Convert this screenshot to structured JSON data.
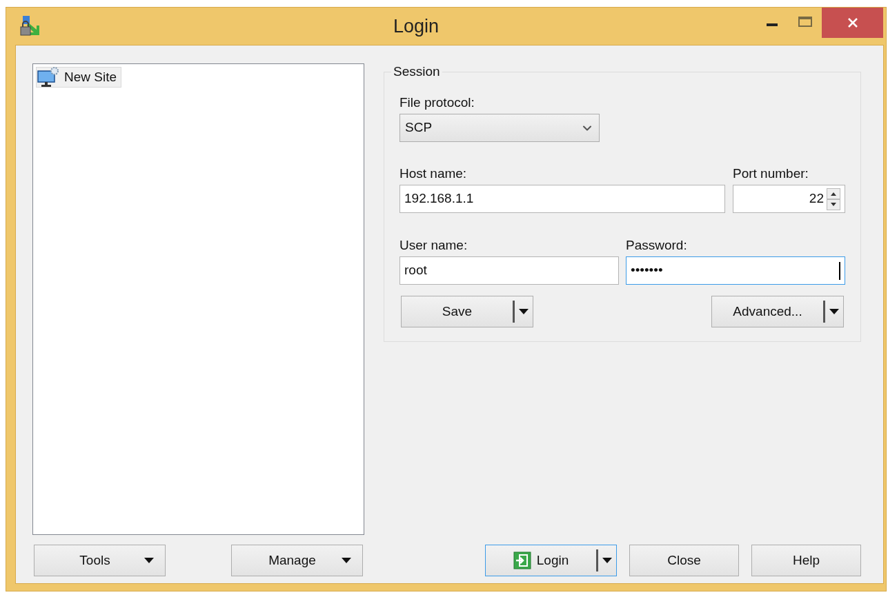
{
  "window": {
    "title": "Login"
  },
  "site_tree": {
    "items": [
      {
        "label": "New Site",
        "selected": true
      }
    ]
  },
  "left_buttons": [
    {
      "label": "Tools",
      "kind": "menu",
      "default": false
    },
    {
      "label": "Manage",
      "kind": "menu",
      "default": false
    }
  ],
  "session": {
    "title": "Session",
    "file_protocol": {
      "label": "File protocol:",
      "value": "SCP"
    },
    "host_name": {
      "label": "Host name:",
      "value": "192.168.1.1",
      "focused": false
    },
    "port_number": {
      "label": "Port number:",
      "value": "22",
      "focused": false
    },
    "user_name": {
      "label": "User name:",
      "value": "root",
      "focused": false
    },
    "password": {
      "label": "Password:",
      "value": "•••••••",
      "focused": true
    },
    "buttons": [
      {
        "label": "Save",
        "kind": "split",
        "default": false
      },
      {
        "label": "Advanced...",
        "kind": "split",
        "default": false
      }
    ]
  },
  "bottom_buttons": [
    {
      "label": "Login",
      "kind": "split",
      "default": true
    },
    {
      "label": "Close",
      "kind": "plain",
      "default": false
    },
    {
      "label": "Help",
      "kind": "plain",
      "default": false
    }
  ]
}
